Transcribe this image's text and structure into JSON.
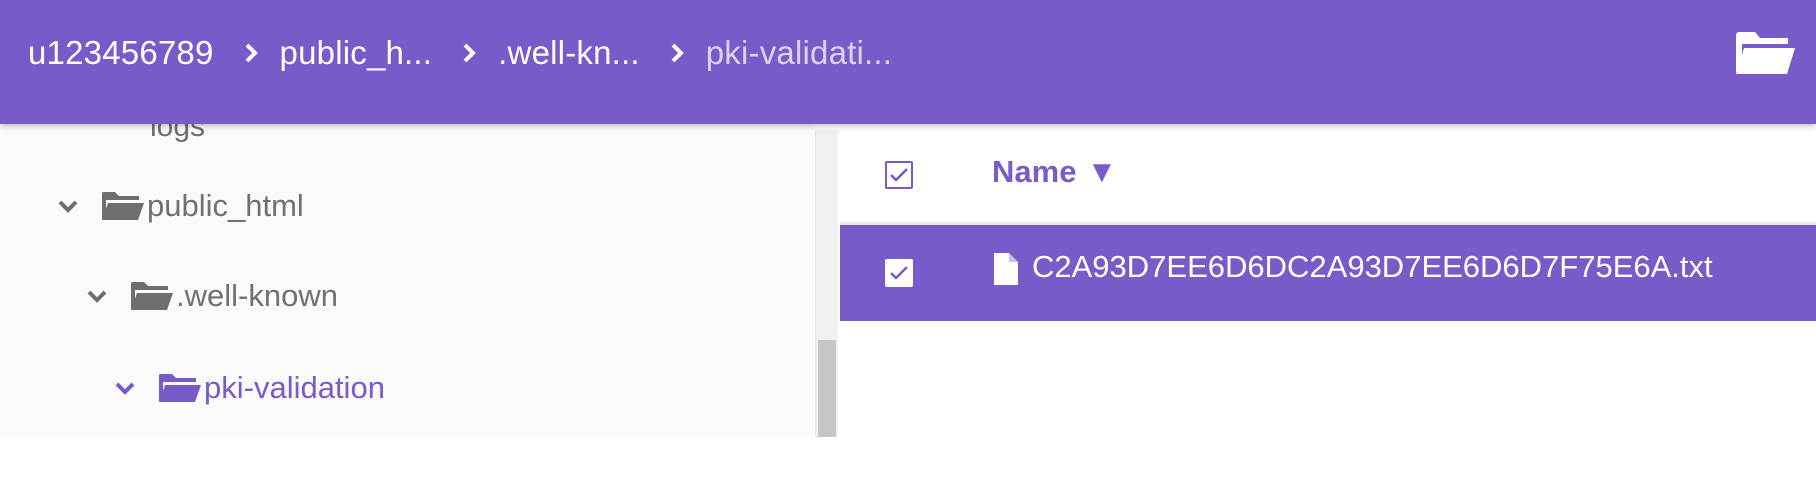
{
  "breadcrumb": {
    "items": [
      "u123456789",
      "public_h...",
      ".well-kn...",
      "pki-validati..."
    ]
  },
  "tree": {
    "cut_label": "logs",
    "items": [
      {
        "label": "public_html"
      },
      {
        "label": ".well-known"
      },
      {
        "label": "pki-validation"
      }
    ]
  },
  "list": {
    "name_header": "Name",
    "sort_indicator": "▼",
    "rows": [
      {
        "name": "C2A93D7EE6D6DC2A93D7EE6D6D7F75E6A.txt"
      }
    ]
  },
  "colors": {
    "accent": "#785ac8",
    "tree_bg": "#fafafa",
    "tree_text": "#707070"
  },
  "icons": {
    "topbar": "folder-open-icon",
    "tree": "folder-open-icon",
    "file": "file-icon",
    "expand": "chevron-down-icon",
    "separator": "chevron-right-icon"
  }
}
